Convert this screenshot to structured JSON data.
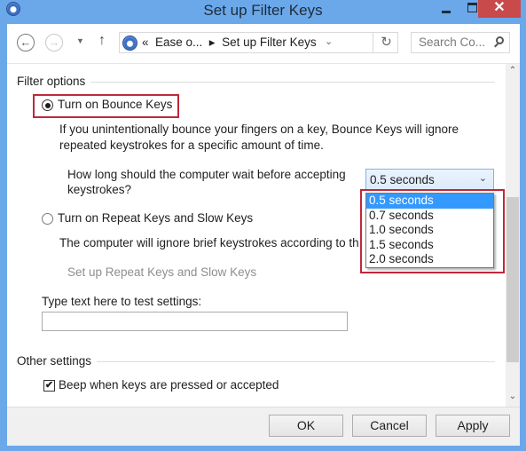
{
  "window": {
    "title": "Set up Filter Keys",
    "close_glyph": "✕"
  },
  "nav": {
    "back_glyph": "←",
    "forward_glyph": "→",
    "recent_glyph": "▼",
    "up_glyph": "↑",
    "address": "«  Ease o...  ▸  Set up Filter Keys",
    "address_dropdown_glyph": "⌄",
    "refresh_glyph": "↻",
    "search_placeholder": "Search Co..."
  },
  "filter_options": {
    "label": "Filter options",
    "bounce_keys": {
      "label": "Turn on Bounce Keys",
      "checked": true,
      "description_line1": "If you unintentionally bounce your fingers on a key, Bounce Keys will ignore",
      "description_line2": "repeated keystrokes for a specific amount of time.",
      "wait_question_line1": "How long should the computer wait before accepting",
      "wait_question_line2": "keystrokes?",
      "wait_selected": "0.5 seconds",
      "wait_options": [
        "0.5 seconds",
        "0.7 seconds",
        "1.0 seconds",
        "1.5 seconds",
        "2.0 seconds"
      ],
      "dropdown_arrow_glyph": "⌄"
    },
    "repeat_slow_keys": {
      "label": "Turn on Repeat Keys and Slow Keys",
      "checked": false,
      "description": "The computer will ignore brief keystrokes according to th",
      "setup_link": "Set up Repeat Keys and Slow Keys"
    },
    "test_label": "Type text here to test settings:",
    "test_value": ""
  },
  "other_settings": {
    "label": "Other settings",
    "beep": {
      "label": "Beep when keys are pressed or accepted",
      "checked": true,
      "check_glyph": "✔"
    }
  },
  "scrollbar": {
    "up_glyph": "⌃",
    "down_glyph": "⌄"
  },
  "buttons": {
    "ok": "OK",
    "cancel": "Cancel",
    "apply": "Apply"
  },
  "colors": {
    "highlight": "#c0283a",
    "selection": "#3399ff",
    "titlebar": "#6aa8ea",
    "close": "#c94a4a"
  }
}
